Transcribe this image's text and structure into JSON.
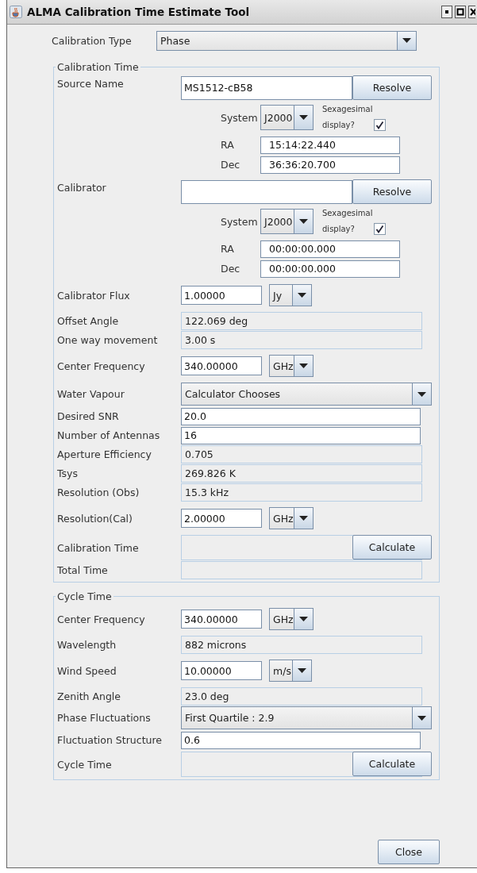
{
  "window": {
    "title": "ALMA Calibration Time Estimate Tool"
  },
  "calibration_type": {
    "label": "Calibration Type",
    "value": "Phase"
  },
  "sections": [
    {
      "title": "Calibration Time",
      "rows": [
        {
          "kind": "input",
          "label": "Source Name",
          "value": "MS1512-cB58",
          "button": "Resolve"
        },
        {
          "kind": "coords",
          "system_label": "System",
          "system": "J2000",
          "checkbox_label": "Sexagesimal display?",
          "checked": true,
          "ra_label": "RA",
          "ra": "15:14:22.440",
          "dec_label": "Dec",
          "dec": "36:36:20.700"
        },
        {
          "kind": "input",
          "label": "Calibrator",
          "button": "Resolve"
        },
        {
          "kind": "coords",
          "system_label": "System",
          "system": "J2000",
          "checkbox_label": "Sexagesimal display?",
          "checked": true,
          "ra_label": "RA",
          "ra": "00:00:00.000",
          "dec_label": "Dec",
          "dec": "00:00:00.000"
        },
        {
          "kind": "input",
          "label": "Calibrator Flux",
          "value": "1.00000",
          "unit": "Jy"
        },
        {
          "kind": "readout",
          "label": "Offset Angle",
          "value": "122.069 deg"
        },
        {
          "kind": "readout",
          "label": "One way movement",
          "value": "3.00 s"
        },
        {
          "kind": "input",
          "label": "Center Frequency",
          "value": "340.00000",
          "unit": "GHz"
        },
        {
          "kind": "combo",
          "label": "Water Vapour",
          "value": "Calculator Chooses"
        },
        {
          "kind": "input",
          "label": "Desired SNR",
          "value": "20.0"
        },
        {
          "kind": "input",
          "label": "Number of Antennas",
          "value": "16"
        },
        {
          "kind": "readout",
          "label": "Aperture Efficiency",
          "value": "0.705"
        },
        {
          "kind": "readout",
          "label": "Tsys",
          "value": "269.826 K"
        },
        {
          "kind": "readout",
          "label": "Resolution (Obs)",
          "value": "15.3 kHz"
        },
        {
          "kind": "input",
          "label": "Resolution(Cal)",
          "value": "2.00000",
          "unit": "GHz"
        },
        {
          "kind": "calc",
          "label": "Calibration Time",
          "button": "Calculate"
        },
        {
          "kind": "readout",
          "label": "Total Time"
        }
      ]
    },
    {
      "title": "Cycle Time",
      "rows": [
        {
          "kind": "input",
          "label": "Center Frequency",
          "value": "340.00000",
          "unit": "GHz"
        },
        {
          "kind": "readout",
          "label": "Wavelength",
          "value": "882 microns"
        },
        {
          "kind": "input",
          "label": "Wind Speed",
          "value": "10.00000",
          "unit": "m/s"
        },
        {
          "kind": "readout",
          "label": "Zenith Angle",
          "value": "23.0 deg"
        },
        {
          "kind": "combo",
          "label": "Phase Fluctuations",
          "value": "First Quartile : 2.9"
        },
        {
          "kind": "input",
          "label": "Fluctuation Structure",
          "value": "0.6"
        },
        {
          "kind": "calc",
          "label": "Cycle Time",
          "button": "Calculate"
        }
      ]
    }
  ],
  "close_button": "Close"
}
